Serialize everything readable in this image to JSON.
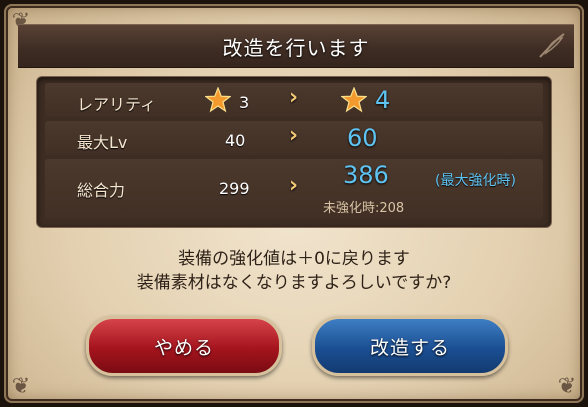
{
  "dialog": {
    "title": "改造を行います"
  },
  "stats": {
    "rarity": {
      "label": "レアリティ",
      "old": "3",
      "arrow": "›",
      "new": "4",
      "icon": "star-icon"
    },
    "max_lv": {
      "label": "最大Lv",
      "old": "40",
      "arrow": "›",
      "new": "60"
    },
    "total_power": {
      "label": "総合力",
      "old": "299",
      "arrow": "›",
      "new": "386",
      "max_note": "(最大強化時)",
      "unenhanced": "未強化時:208"
    }
  },
  "message": {
    "line1": "装備の強化値は＋0に戻ります",
    "line2": "装備素材はなくなりますよろしいですか?"
  },
  "buttons": {
    "cancel_label": "やめる",
    "confirm_label": "改造する"
  },
  "colors": {
    "accent_blue": "#5fc3f2",
    "arrow_gold": "#f3c877",
    "cancel_red": "#a5141d",
    "confirm_blue": "#1b4f93"
  }
}
